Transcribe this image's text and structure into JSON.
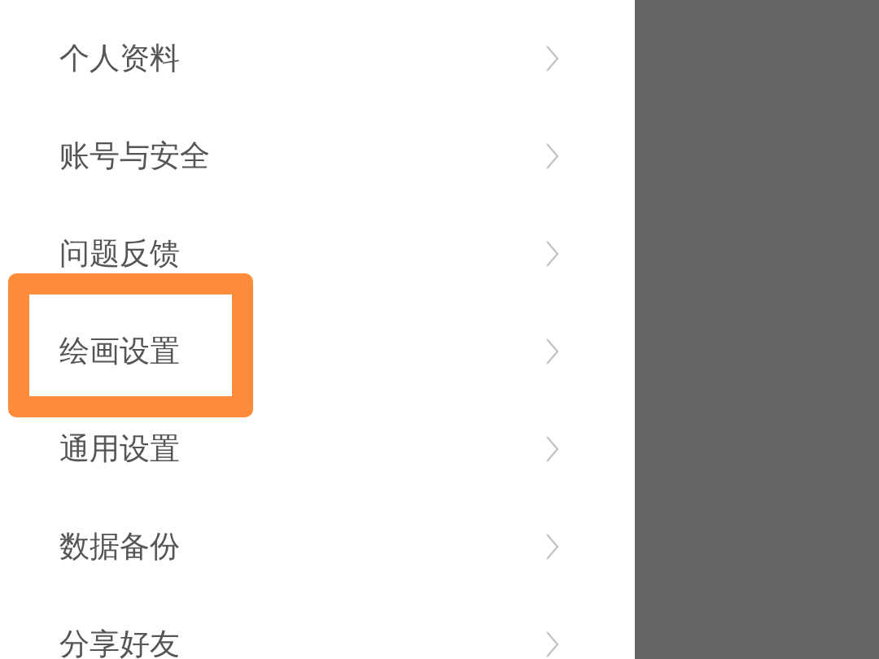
{
  "menu": [
    {
      "label": "个人资料",
      "highlighted": false
    },
    {
      "label": "账号与安全",
      "highlighted": false
    },
    {
      "label": "问题反馈",
      "highlighted": false
    },
    {
      "label": "绘画设置",
      "highlighted": true
    },
    {
      "label": "通用设置",
      "highlighted": false
    },
    {
      "label": "数据备份",
      "highlighted": false
    },
    {
      "label": "分享好友",
      "highlighted": false
    }
  ]
}
